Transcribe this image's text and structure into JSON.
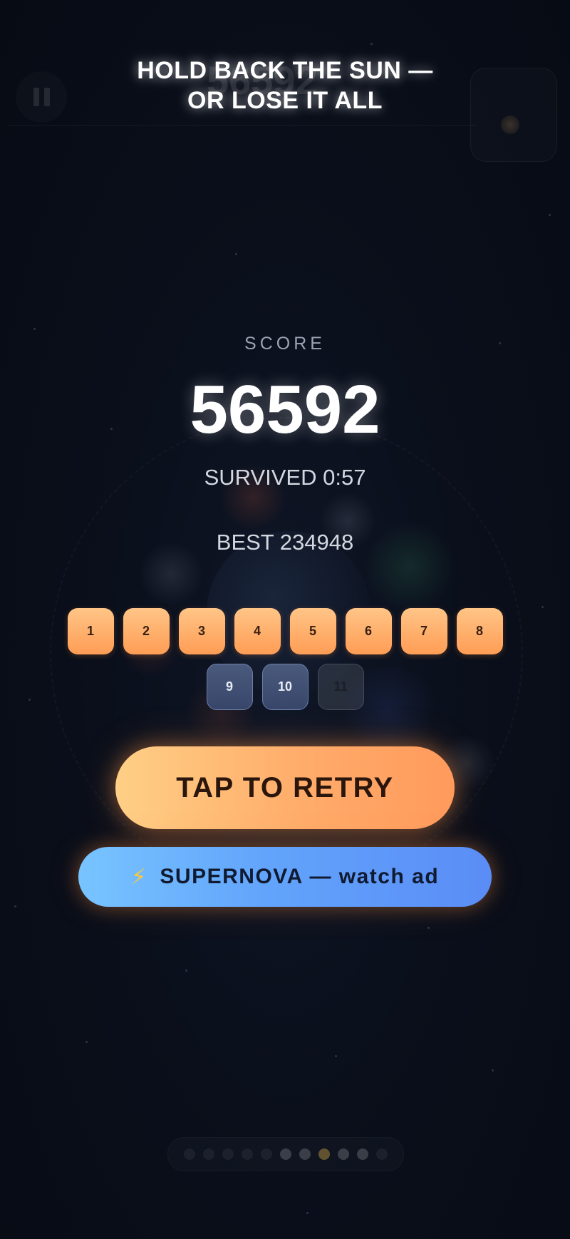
{
  "headline": {
    "line1": "HOLD BACK THE SUN —",
    "line2": "OR LOSE IT ALL"
  },
  "background_hud": {
    "score": "56592",
    "icons": [
      "pause-icon",
      "next-planet-icon"
    ]
  },
  "results": {
    "score_label": "SCORE",
    "score_value": "56592",
    "survived": "SURVIVED 0:57",
    "best": "BEST 234948"
  },
  "levels": {
    "row1": [
      "1",
      "2",
      "3",
      "4",
      "5",
      "6",
      "7",
      "8"
    ],
    "row2": [
      "9",
      "10",
      "11"
    ],
    "states_row2": [
      "unlocked",
      "unlocked",
      "locked"
    ]
  },
  "buttons": {
    "retry": "TAP TO RETRY",
    "supernova_icon": "lightning-bolt-icon",
    "supernova": "SUPERNOVA — watch ad"
  },
  "pager": {
    "dot_count": 11,
    "active_index": 7
  },
  "colors": {
    "background": "#0a0f1b",
    "retry_button": "#ffac6a",
    "supernova_button": "#62a4fb",
    "level_done": "#ffb06b",
    "level_unlocked": "#3f4e72",
    "level_locked": "#464e5c"
  }
}
